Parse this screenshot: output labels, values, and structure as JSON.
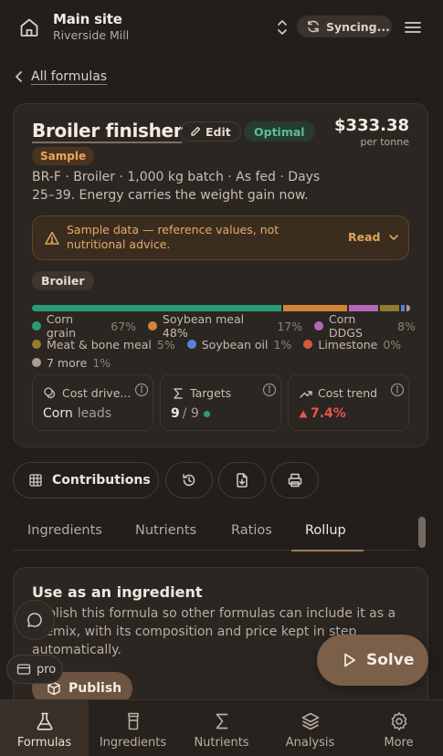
{
  "header": {
    "site_title": "Main site",
    "site_subtitle": "Riverside Mill",
    "sync_status": "Syncing..."
  },
  "back_link": "All formulas",
  "formula": {
    "name": "Broiler finisher",
    "edit_label": "Edit",
    "status": "Optimal",
    "price": "$333.38",
    "price_unit": "per tonne",
    "sample_badge": "Sample",
    "description": "BR-F · Broiler · 1,000 kg batch · As fed · Days 25–39. Energy carries the weight gain now.",
    "notice": "Sample data — reference values, not nutritional advice.",
    "notice_action": "Read",
    "species": "Broiler"
  },
  "composition": [
    {
      "name": "Corn grain",
      "pct": "67%",
      "value": 67,
      "color": "#2a9d78"
    },
    {
      "name": "Soybean meal 48%",
      "pct": "17%",
      "value": 17,
      "color": "#d08536"
    },
    {
      "name": "Corn DDGS",
      "pct": "8%",
      "value": 8,
      "color": "#b268b8"
    },
    {
      "name": "Meat & bone meal",
      "pct": "5%",
      "value": 5,
      "color": "#8f7d2c"
    },
    {
      "name": "Soybean oil",
      "pct": "1%",
      "value": 1,
      "color": "#4f86d6"
    },
    {
      "name": "Limestone",
      "pct": "0%",
      "value": 0,
      "color": "#d9583e"
    },
    {
      "name": "7 more",
      "pct": "1%",
      "value": 1,
      "color": "#a89e94"
    }
  ],
  "stats": {
    "cost_driver_label": "Cost drive...",
    "cost_driver_value": "Corn",
    "cost_driver_suffix": "leads",
    "targets_label": "Targets",
    "targets_met": "9",
    "targets_total": "/ 9",
    "cost_trend_label": "Cost trend",
    "cost_trend_value": "7.4%",
    "colors": {
      "ok": "#2a9d78",
      "up": "#e2574c"
    }
  },
  "actions": {
    "contributions_label": "Contributions"
  },
  "tabs": [
    {
      "label": "Ingredients"
    },
    {
      "label": "Nutrients"
    },
    {
      "label": "Ratios"
    },
    {
      "label": "Rollup",
      "active": true
    }
  ],
  "ingredient_card": {
    "title": "Use as an ingredient",
    "body": "Publish this formula so other formulas can include it as a premix, with its composition and price kept in step automatically.",
    "publish_label": "Publish"
  },
  "floating": {
    "pro_label": "pro",
    "solve_label": "Solve"
  },
  "bottom_nav": [
    {
      "label": "Formulas",
      "icon": "flask-icon",
      "active": true
    },
    {
      "label": "Ingredients",
      "icon": "jar-icon"
    },
    {
      "label": "Nutrients",
      "icon": "sigma-icon"
    },
    {
      "label": "Analysis",
      "icon": "layers-icon"
    },
    {
      "label": "More",
      "icon": "gear-icon"
    }
  ]
}
